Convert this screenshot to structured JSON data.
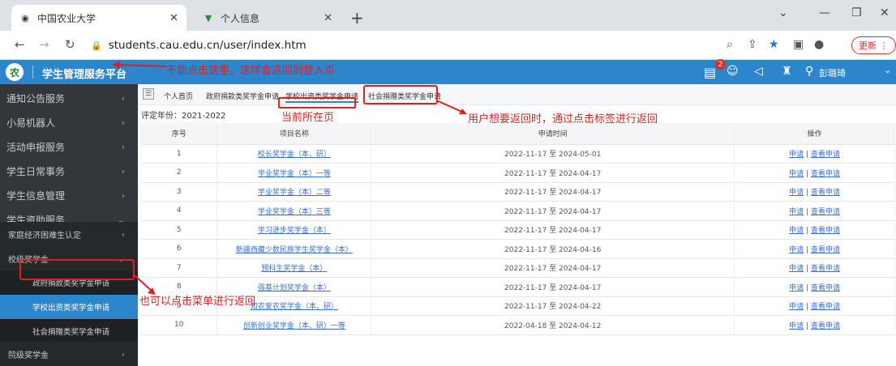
{
  "browser": {
    "tabs": [
      {
        "title": "中国农业大学",
        "active": true
      },
      {
        "title": "个人信息",
        "active": false
      }
    ],
    "url": "students.cau.edu.cn/user/index.htm",
    "update_label": "更新"
  },
  "app": {
    "title": "学生管理服务平台",
    "badge_count": "2",
    "user_name": "彭璐琦"
  },
  "annotations": {
    "back_warning": "不能点击这里，这样会返回到登入页",
    "current_page": "当前所在页",
    "tab_return": "用户想要返回时，通过点击标签进行返回",
    "menu_return": "也可以点击菜单进行返回"
  },
  "sidebar": {
    "items": [
      {
        "label": "通知公告服务",
        "arrow": "›"
      },
      {
        "label": "小易机器人",
        "arrow": "›"
      },
      {
        "label": "活动申报服务",
        "arrow": "›"
      },
      {
        "label": "学生日常事务",
        "arrow": "›"
      },
      {
        "label": "学生信息管理",
        "arrow": "›"
      },
      {
        "label": "学生资助服务",
        "arrow": "⌄"
      }
    ],
    "sub": [
      {
        "label": "家庭经济困难生认定",
        "arrow": "›"
      },
      {
        "label": "校级奖学金",
        "arrow": "⌄"
      }
    ],
    "subsub": [
      {
        "label": "政府捐款类奖学金申请",
        "active": false
      },
      {
        "label": "学校出资类奖学金申请",
        "active": true
      },
      {
        "label": "社会捐赠类奖学金申请",
        "active": false
      }
    ],
    "last": {
      "label": "院级奖学金",
      "arrow": "›"
    }
  },
  "page_tabs": [
    {
      "label": "个人首页"
    },
    {
      "label": "政府捐款类奖学金申请"
    },
    {
      "label": "学校出资类奖学金申请"
    },
    {
      "label": "社会捐赠类奖学金申请"
    }
  ],
  "year_label": "评定年份：2021-2022",
  "table": {
    "headers": [
      "序号",
      "项目名称",
      "申请时间",
      "操作"
    ],
    "op_apply": "申请",
    "op_sep": "|",
    "op_view": "查看申请",
    "rows": [
      {
        "no": "1",
        "name": "校长奖学金（本、研）",
        "time": "2022-11-17 至 2024-05-01"
      },
      {
        "no": "2",
        "name": "学业奖学金（本）一等",
        "time": "2022-11-17 至 2024-04-17"
      },
      {
        "no": "3",
        "name": "学业奖学金（本）二等",
        "time": "2022-11-17 至 2024-04-17"
      },
      {
        "no": "4",
        "name": "学业奖学金（本）三等",
        "time": "2022-11-17 至 2024-04-17"
      },
      {
        "no": "5",
        "name": "学习进步奖学金（本）",
        "time": "2022-11-17 至 2024-04-17"
      },
      {
        "no": "6",
        "name": "新疆西藏少数民族学生奖学金（本）",
        "time": "2022-11-17 至 2024-04-16"
      },
      {
        "no": "7",
        "name": "预科生奖学金（本）",
        "time": "2022-11-17 至 2024-04-17"
      },
      {
        "no": "8",
        "name": "强基计划奖学金（本）",
        "time": "2022-11-17 至 2024-04-17"
      },
      {
        "no": "9",
        "name": "知农爱农奖学金（本、研）",
        "time": "2022-11-17 至 2024-04-22"
      },
      {
        "no": "10",
        "name": "创新创业奖学金（本、研）一等",
        "time": "2022-04-18 至 2024-04-12"
      }
    ]
  }
}
